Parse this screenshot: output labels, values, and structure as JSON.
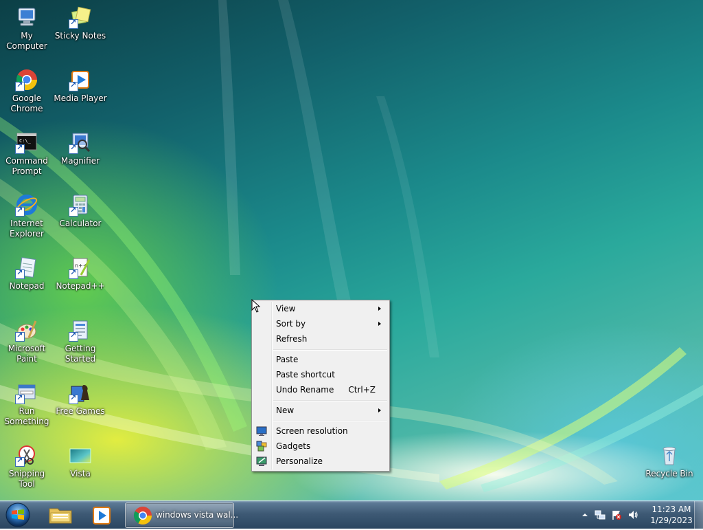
{
  "desktop": {
    "icons": [
      {
        "label": "My Computer",
        "icon": "computer-icon"
      },
      {
        "label": "Sticky Notes",
        "icon": "sticky-notes-icon"
      },
      {
        "label": "Google Chrome",
        "icon": "chrome-icon"
      },
      {
        "label": "Media Player",
        "icon": "media-player-icon"
      },
      {
        "label": "Command Prompt",
        "icon": "command-prompt-icon"
      },
      {
        "label": "Magnifier",
        "icon": "magnifier-icon"
      },
      {
        "label": "Internet Explorer",
        "icon": "internet-explorer-icon"
      },
      {
        "label": "Calculator",
        "icon": "calculator-icon"
      },
      {
        "label": "Notepad",
        "icon": "notepad-icon"
      },
      {
        "label": "Notepad++",
        "icon": "notepad-plus-plus-icon"
      },
      {
        "label": "Microsoft Paint",
        "icon": "paint-icon"
      },
      {
        "label": "Getting Started",
        "icon": "getting-started-icon"
      },
      {
        "label": "Run Something",
        "icon": "run-icon"
      },
      {
        "label": "Free Games",
        "icon": "games-icon"
      },
      {
        "label": "Snipping Tool",
        "icon": "snipping-tool-icon"
      },
      {
        "label": "Vista",
        "icon": "wallpaper-image-icon"
      },
      {
        "label": "Recycle Bin",
        "icon": "recycle-bin-icon"
      }
    ]
  },
  "context_menu": {
    "items": [
      {
        "label": "View",
        "has_submenu": true
      },
      {
        "label": "Sort by",
        "has_submenu": true
      },
      {
        "label": "Refresh"
      },
      {
        "label": "Paste"
      },
      {
        "label": "Paste shortcut"
      },
      {
        "label": "Undo Rename",
        "shortcut": "Ctrl+Z"
      },
      {
        "label": "New",
        "has_submenu": true
      },
      {
        "label": "Screen resolution",
        "icon": "screen-resolution-icon"
      },
      {
        "label": "Gadgets",
        "icon": "gadgets-icon"
      },
      {
        "label": "Personalize",
        "icon": "personalize-icon"
      }
    ]
  },
  "taskbar": {
    "start_icon": "windows-start-orb-icon",
    "pinned": [
      "file-explorer-icon",
      "media-player-icon"
    ],
    "open_window": {
      "label": "windows vista wal...",
      "icon": "chrome-icon"
    },
    "tray": {
      "icons": [
        "show-hidden-icons-arrow",
        "network-icon",
        "action-center-flag-icon",
        "volume-icon"
      ],
      "time": "11:23 AM",
      "date": "1/29/2023"
    }
  },
  "colors": {
    "taskbar": "#3e5a75",
    "menu_background": "#f0f0f0",
    "wallpaper_teal": "#1b8a8b",
    "wallpaper_green": "#6ed746",
    "wallpaper_yellow": "#ebf03c"
  }
}
